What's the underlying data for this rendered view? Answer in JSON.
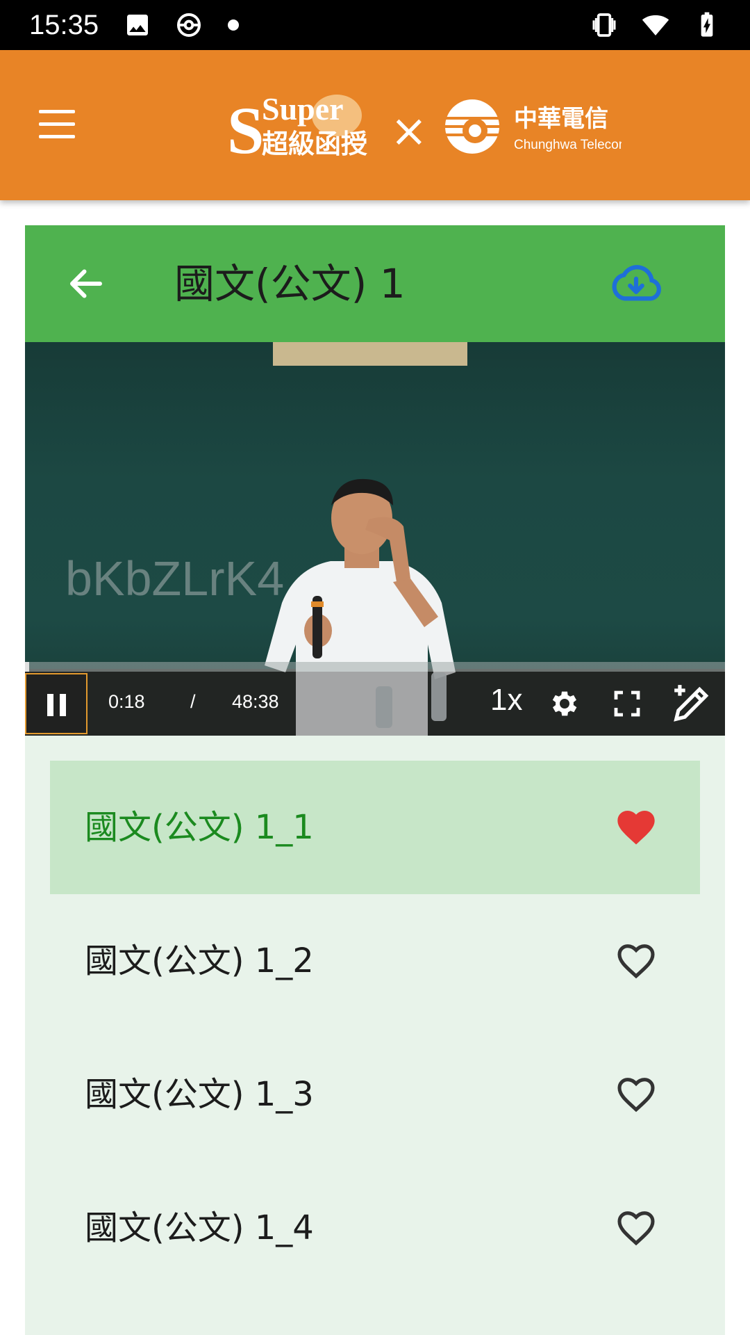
{
  "status_bar": {
    "time": "15:35",
    "icons_left": [
      "image-icon",
      "sync-icon",
      "dot-icon"
    ],
    "icons_right": [
      "vibrate-icon",
      "wifi-icon",
      "battery-charging-icon"
    ]
  },
  "app_bar": {
    "menu_icon": "menu-icon",
    "logo": {
      "brand_en": "Super",
      "brand_zh": "超級函授",
      "separator": "×",
      "partner_zh": "中華電信",
      "partner_en": "Chunghwa Telecom"
    }
  },
  "lesson": {
    "title": "國文(公文) 1",
    "back_icon": "arrow-back-icon",
    "download_icon": "cloud-download-icon"
  },
  "player": {
    "watermark": "bKbZLrK4",
    "current_time": "0:18",
    "separator": "/",
    "total_time": "48:38",
    "speed": "1x",
    "progress_fraction": 0.0062,
    "icons": [
      "pause-icon",
      "settings-icon",
      "fullscreen-icon",
      "edit-note-icon"
    ]
  },
  "playlist": [
    {
      "label": "國文(公文) 1_1",
      "active": true,
      "favorited": true
    },
    {
      "label": "國文(公文) 1_2",
      "active": false,
      "favorited": false
    },
    {
      "label": "國文(公文) 1_3",
      "active": false,
      "favorited": false
    },
    {
      "label": "國文(公文) 1_4",
      "active": false,
      "favorited": false
    }
  ],
  "colors": {
    "app_bar": "#E88426",
    "card_header": "#4FB24F",
    "list_background": "#E8F3EA",
    "active_item": "#C7E6C8",
    "active_text": "#1B8A1F",
    "heart_filled": "#E53935",
    "download_icon": "#1E6FD9"
  }
}
